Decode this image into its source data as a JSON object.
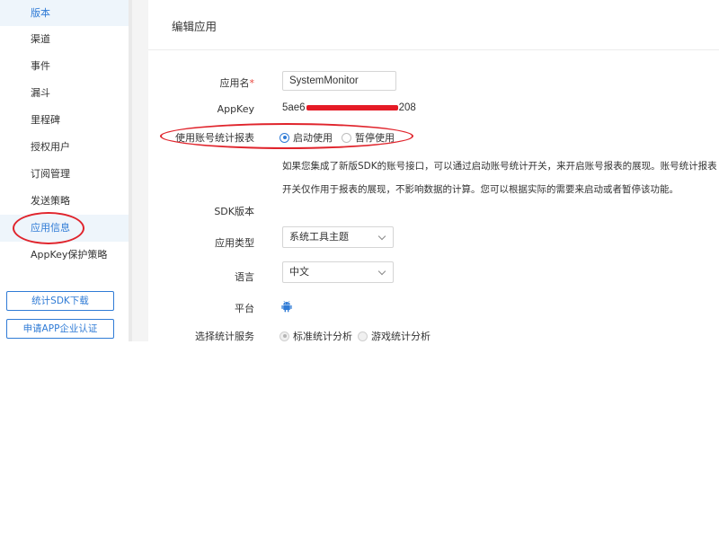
{
  "sidebar": {
    "items": [
      {
        "label": "版本"
      },
      {
        "label": "渠道"
      },
      {
        "label": "事件"
      },
      {
        "label": "漏斗"
      },
      {
        "label": "里程碑"
      },
      {
        "label": "授权用户"
      },
      {
        "label": "订阅管理"
      },
      {
        "label": "发送策略"
      },
      {
        "label": "应用信息"
      },
      {
        "label": "AppKey保护策略"
      }
    ],
    "buttons": [
      {
        "label": "统计SDK下载"
      },
      {
        "label": "申请APP企业认证"
      }
    ]
  },
  "main": {
    "title": "编辑应用",
    "app_name": {
      "label": "应用名",
      "required_mark": "*",
      "value": "SystemMonitor"
    },
    "appkey": {
      "label": "AppKey",
      "prefix": "5ae6",
      "suffix": "208"
    },
    "account_stats": {
      "label": "使用账号统计报表",
      "options": [
        {
          "label": "启动使用",
          "selected": true
        },
        {
          "label": "暂停使用",
          "selected": false
        }
      ]
    },
    "description": {
      "line1": "如果您集成了新版SDK的账号接口，可以通过启动账号统计开关，来开启账号报表的展现。账号统计报表",
      "line2": "开关仅作用于报表的展现，不影响数据的计算。您可以根据实际的需要来启动或者暂停该功能。"
    },
    "sdk_version": {
      "label": "SDK版本"
    },
    "app_type": {
      "label": "应用类型",
      "value": "系统工具主题"
    },
    "language": {
      "label": "语言",
      "value": "中文"
    },
    "platform": {
      "label": "平台",
      "icon": "android-icon"
    },
    "stats_service": {
      "label": "选择统计服务",
      "options": [
        {
          "label": "标准统计分析",
          "selected": true,
          "disabled": true
        },
        {
          "label": "游戏统计分析",
          "selected": false,
          "disabled": true
        }
      ]
    }
  },
  "colors": {
    "accent": "#2f7bd6",
    "annotation": "#e0242c",
    "redaction": "#e51b26",
    "android": "#2f7bd6"
  }
}
